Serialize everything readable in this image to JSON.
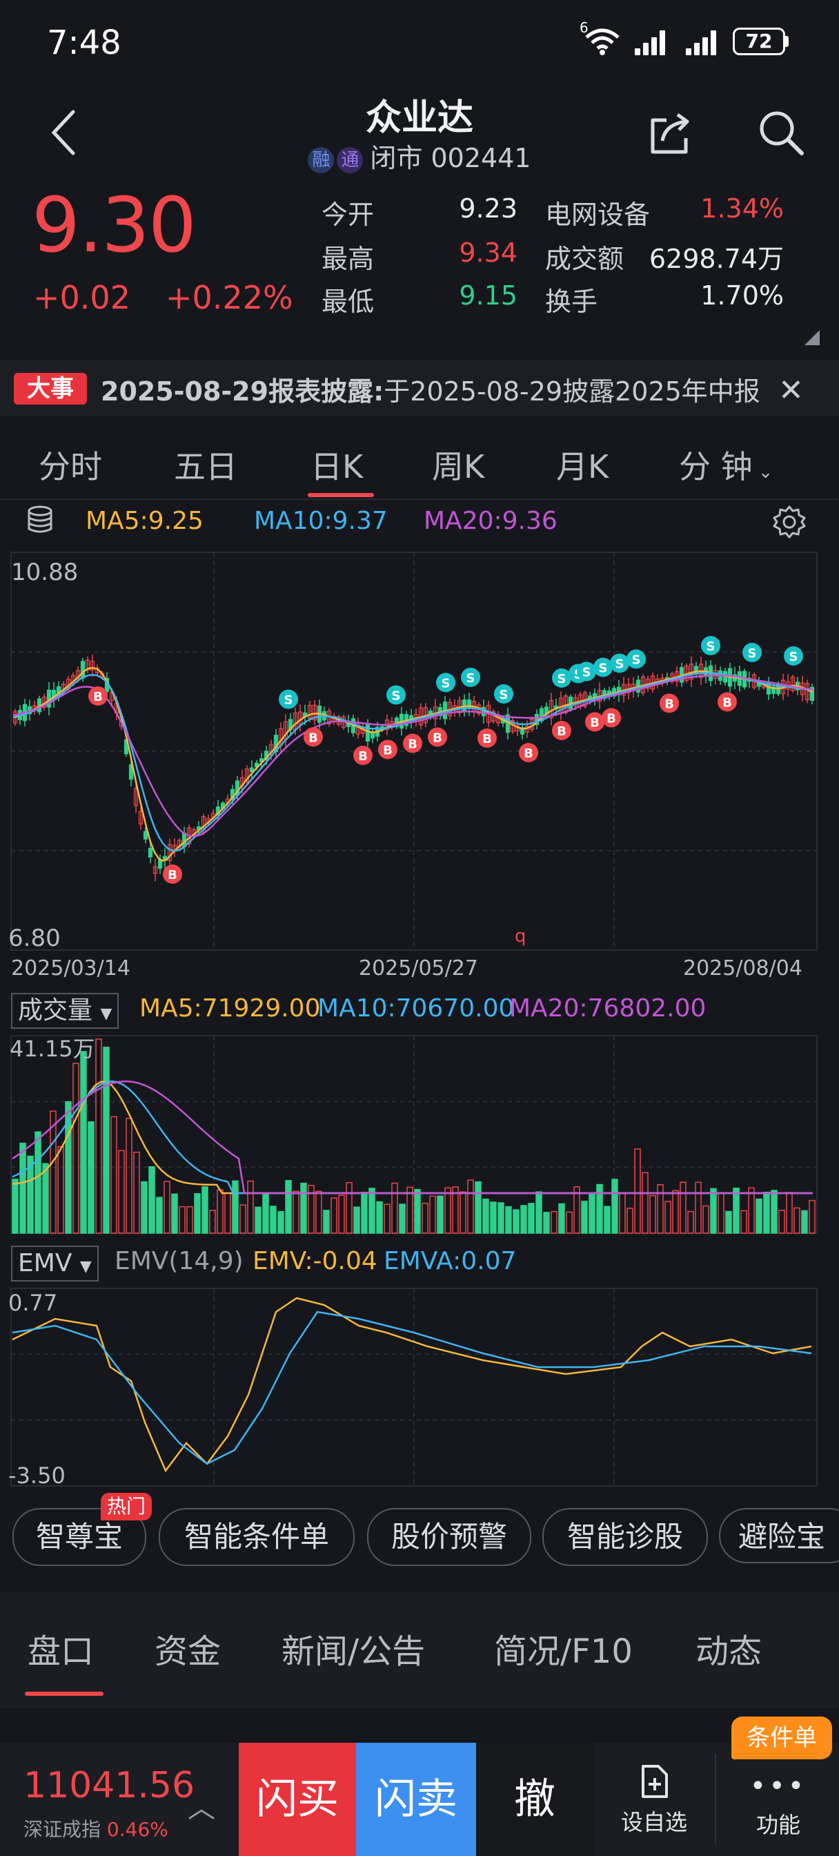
{
  "status_bar": {
    "time": "7:48",
    "wifi_label": "6",
    "battery": "72"
  },
  "header": {
    "title": "众业达",
    "tag_rong": "融",
    "tag_tong": "通",
    "status": "闭市 002441"
  },
  "quote": {
    "price": "9.30",
    "change": "+0.02",
    "change_pct": "+0.22%",
    "open_label": "今开",
    "open": "9.23",
    "high_label": "最高",
    "high": "9.34",
    "low_label": "最低",
    "low": "9.15",
    "sector_label": "电网设备",
    "sector_pct": "1.34%",
    "turnover_label": "成交额",
    "turnover": "6298.74万",
    "rate_label": "换手",
    "rate": "1.70%"
  },
  "event": {
    "badge": "大事",
    "text_bold": "2025-08-29报表披露:",
    "text": "于2025-08-29披露2025年中报"
  },
  "period_tabs": [
    "分时",
    "五日",
    "日K",
    "周K",
    "月K",
    "分 钟"
  ],
  "active_period": 2,
  "ma_legend": {
    "ma5": "MA5:9.25",
    "ma10": "MA10:9.37",
    "ma20": "MA20:9.36"
  },
  "kline": {
    "y_max": "10.88",
    "y_min": "6.80",
    "dates": [
      "2025/03/14",
      "2025/05/27",
      "2025/08/04"
    ],
    "marker": "q"
  },
  "volume": {
    "selector": "成交量",
    "ma5": "MA5:71929.00",
    "ma10": "MA10:70670.00",
    "ma20": "MA20:76802.00",
    "y_max": "41.15万"
  },
  "emv": {
    "selector": "EMV",
    "params": "EMV(14,9)",
    "emv": "EMV:-0.04",
    "emva": "EMVA:0.07",
    "y_max": "0.77",
    "y_min": "-3.50"
  },
  "features": {
    "hot": "热门",
    "items": [
      "智尊宝",
      "智能条件单",
      "股价预警",
      "智能诊股",
      "避险宝"
    ]
  },
  "section_tabs": [
    "盘口",
    "资金",
    "新闻/公告",
    "简况/F10",
    "动态"
  ],
  "bottom": {
    "index_value": "11041.56",
    "index_name": "深证成指",
    "index_pct": "0.46%",
    "buy": "闪买",
    "sell": "闪卖",
    "cancel": "撤",
    "watchlist": "设自选",
    "function": "功能",
    "badge": "条件单"
  },
  "colors": {
    "up": "#f0474c",
    "down": "#2fcf8c",
    "ma5": "#f6b73c",
    "ma10": "#3fb4f0",
    "ma20": "#c455d6"
  }
}
